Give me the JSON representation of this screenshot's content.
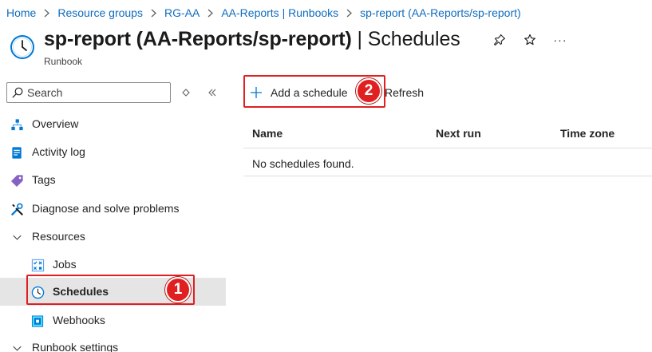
{
  "breadcrumb": {
    "items": [
      "Home",
      "Resource groups",
      "RG-AA",
      "AA-Reports | Runbooks",
      "sp-report (AA-Reports/sp-report)"
    ]
  },
  "header": {
    "title_main": "sp-report (AA-Reports/sp-report)",
    "title_sep": " | ",
    "title_section": "Schedules",
    "subtitle": "Runbook",
    "icon": "clock-icon",
    "actions": [
      "pin-icon",
      "star-icon",
      "more-icon"
    ],
    "more_label": "···"
  },
  "sidebar": {
    "search_placeholder": "Search",
    "items": [
      {
        "label": "Overview",
        "icon": "overview-icon"
      },
      {
        "label": "Activity log",
        "icon": "activity-log-icon"
      },
      {
        "label": "Tags",
        "icon": "tag-icon"
      },
      {
        "label": "Diagnose and solve problems",
        "icon": "wrench-icon"
      },
      {
        "label": "Resources",
        "icon": "chevron-down-icon"
      },
      {
        "label": "Jobs",
        "icon": "jobs-icon"
      },
      {
        "label": "Schedules",
        "icon": "clock-icon",
        "selected": true
      },
      {
        "label": "Webhooks",
        "icon": "webhook-icon"
      },
      {
        "label": "Runbook settings",
        "icon": "chevron-down-icon"
      }
    ]
  },
  "toolbar": {
    "add_schedule_label": "Add a schedule",
    "refresh_label": "Refresh"
  },
  "table": {
    "columns": [
      "Name",
      "Next run",
      "Time zone"
    ],
    "empty_message": "No schedules found."
  },
  "annotations": {
    "badge_1": "1",
    "badge_2": "2"
  },
  "colors": {
    "link": "#0f6cbd",
    "accent_blue": "#0078d4",
    "selected_bg": "#e5e5e5",
    "annotation_red": "#e02020"
  }
}
